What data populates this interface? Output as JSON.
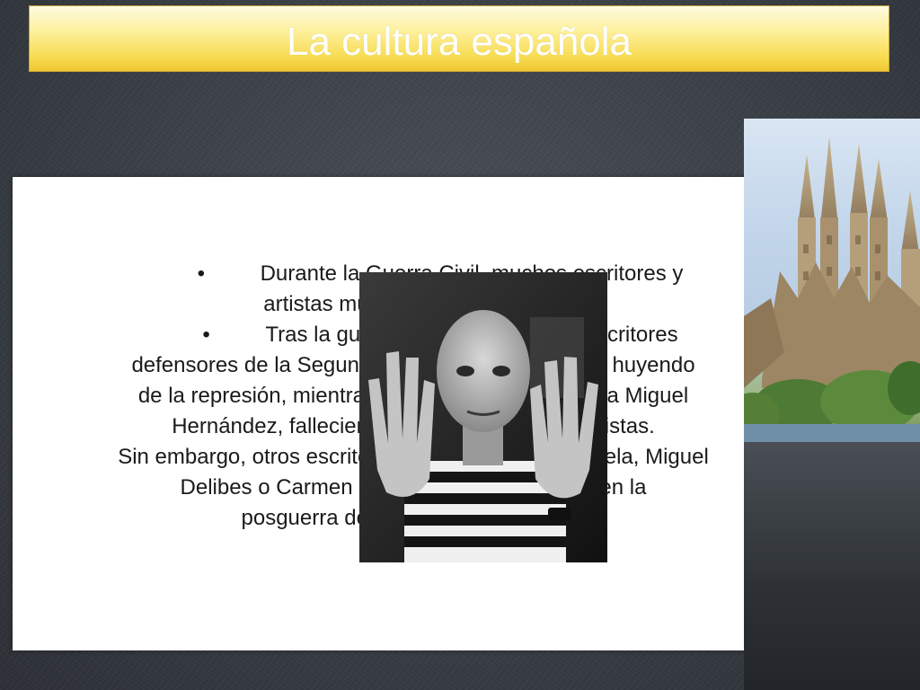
{
  "slide": {
    "title": "La cultura española",
    "lines": [
      {
        "bullet": "•",
        "text": "Durante la Guerra Civil, muchos escritores y"
      },
      {
        "text": "artistas murieron o se exiliaron."
      },
      {
        "bullet": "•",
        "text": "Tras la guerra, muchos artistas y escritores"
      },
      {
        "text": "defensores de la Segunda República se exiliaron, huyendo"
      },
      {
        "text": "de la represión, mientras que otros, como el poeta Miguel"
      },
      {
        "text": "Hernández, fallecieron en las cárceles franquistas."
      },
      {
        "text": "Sin embargo, otros escritores como Camilo José Cela, Miguel"
      },
      {
        "text": "Delibes o Carmen Laforet retrataron la vida en la"
      },
      {
        "text": "posguerra desde dentro de España."
      }
    ]
  },
  "images": {
    "portrait": "portrait-photo",
    "cathedral": "sagrada-familia-photo"
  },
  "colors": {
    "title_bar": "#f8dc52",
    "background": "#3a3f46",
    "panel": "#ffffff"
  }
}
